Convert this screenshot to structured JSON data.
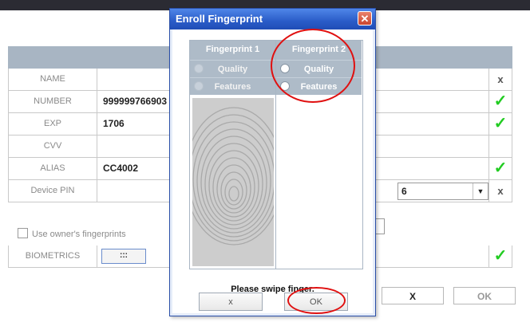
{
  "form": {
    "rows": [
      {
        "label": "NAME",
        "value": "",
        "status": "x"
      },
      {
        "label": "NUMBER",
        "value": "999999766903",
        "status": "✓"
      },
      {
        "label": "EXP",
        "value": "1706",
        "status": "✓"
      },
      {
        "label": "CVV",
        "value": "",
        "status": ""
      },
      {
        "label": "ALIAS",
        "value": "CC4002",
        "status": "✓"
      },
      {
        "label": "Device PIN",
        "value": "",
        "status": "x"
      }
    ],
    "pin_value": "6",
    "owner_fingerprints_label": "Use owner's fingerprints",
    "biometrics_label": "BIOMETRICS",
    "biometrics_button": ":::",
    "biometrics_status": "✓",
    "cancel_label": "X",
    "ok_label": "OK"
  },
  "dialog": {
    "title": "Enroll Fingerprint",
    "close_glyph": "✕",
    "fingerprint1": {
      "header": "Fingerprint 1",
      "quality": "Quality",
      "features": "Features"
    },
    "fingerprint2": {
      "header": "Fingerprint 2",
      "quality": "Quality",
      "features": "Features"
    },
    "message": "Please swipe finger.",
    "cancel_label": "x",
    "ok_label": "OK"
  },
  "colors": {
    "accent": "#2a5cc8",
    "check": "#22cc22",
    "highlight": "#e01010"
  }
}
